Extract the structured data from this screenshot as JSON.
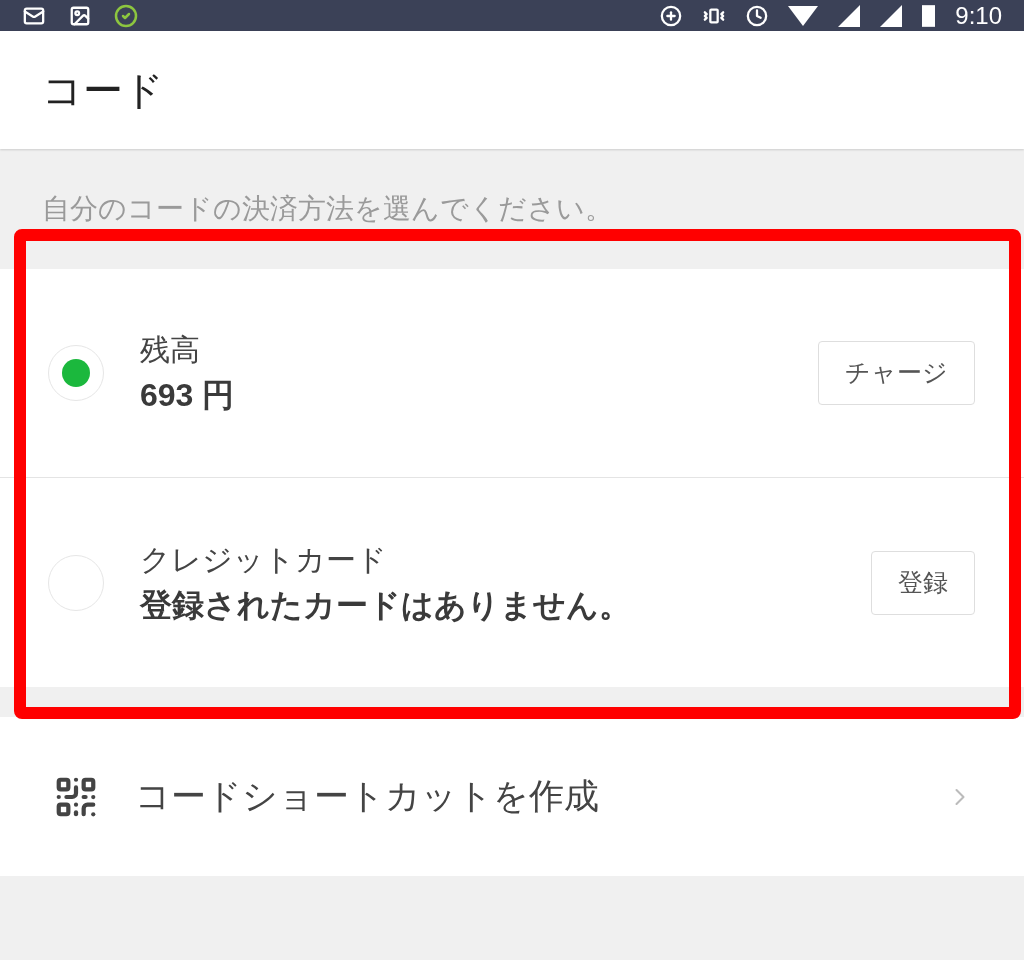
{
  "status_bar": {
    "time": "9:10"
  },
  "header": {
    "title": "コード"
  },
  "instruction": "自分のコードの決済方法を選んでください。",
  "payment_methods": [
    {
      "label": "残高",
      "detail": "693 円",
      "selected": true,
      "button": "チャージ"
    },
    {
      "label": "クレジットカード",
      "detail": "登録されたカードはありません。",
      "selected": false,
      "button": "登録"
    }
  ],
  "shortcut": {
    "label": "コードショートカットを作成"
  }
}
